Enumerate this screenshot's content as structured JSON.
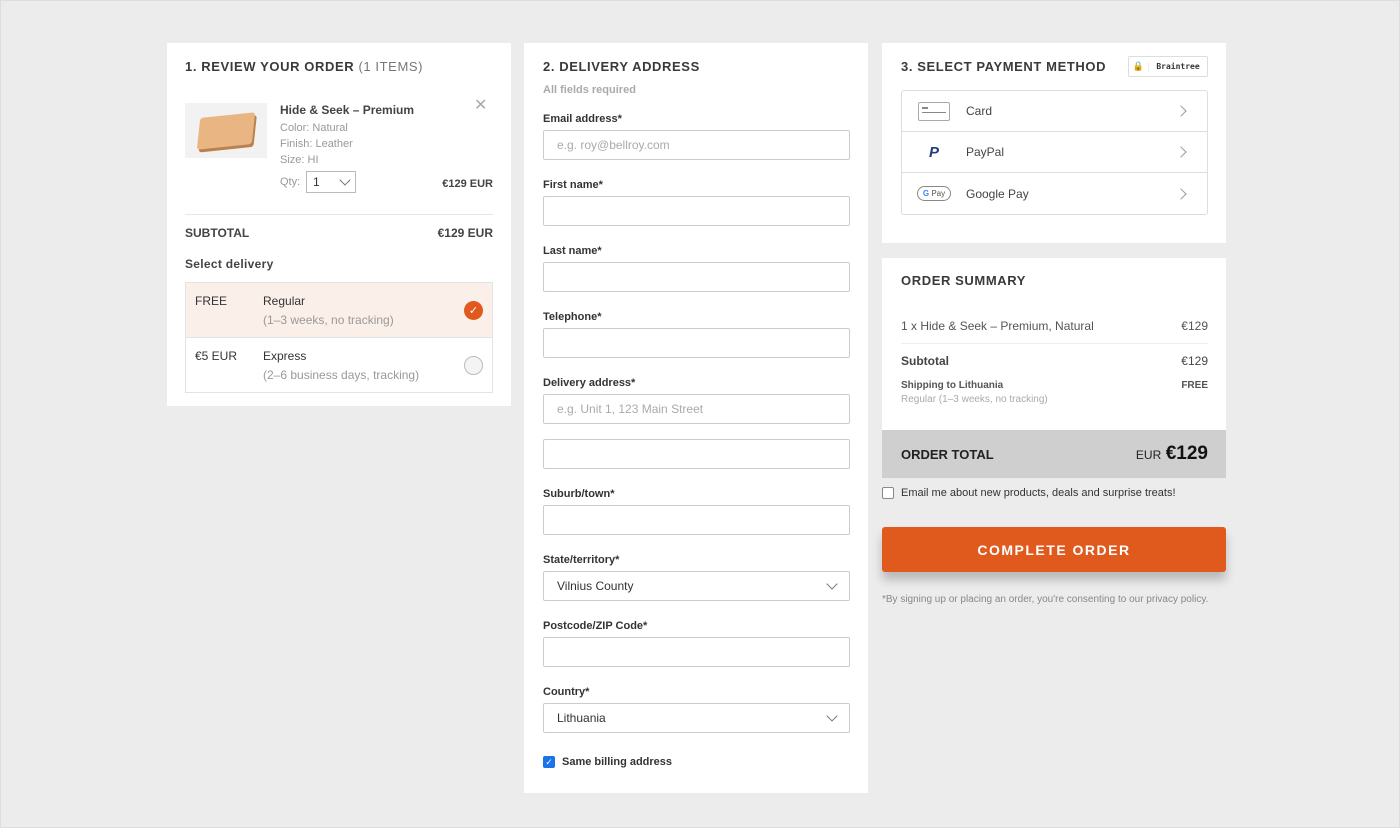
{
  "review": {
    "title": "1. REVIEW YOUR ORDER",
    "count": "(1 ITEMS)",
    "item": {
      "name": "Hide & Seek – Premium",
      "color": "Color: Natural",
      "finish": "Finish: Leather",
      "size": "Size: HI",
      "qty_label": "Qty:",
      "qty": "1",
      "price": "€129 EUR"
    },
    "subtotal_label": "SUBTOTAL",
    "subtotal": "€129 EUR",
    "delivery_label": "Select delivery",
    "delivery_options": [
      {
        "price": "FREE",
        "name": "Regular",
        "desc": "(1–3 weeks, no tracking)",
        "selected": true
      },
      {
        "price": "€5 EUR",
        "name": "Express",
        "desc": "(2–6 business days, tracking)",
        "selected": false
      }
    ]
  },
  "address": {
    "title": "2. DELIVERY ADDRESS",
    "note": "All fields required",
    "email_label": "Email address*",
    "email_placeholder": "e.g. roy@bellroy.com",
    "first_label": "First name*",
    "last_label": "Last name*",
    "phone_label": "Telephone*",
    "addr_label": "Delivery address*",
    "addr_placeholder": "e.g. Unit 1, 123 Main Street",
    "suburb_label": "Suburb/town*",
    "state_label": "State/territory*",
    "state": "Vilnius County",
    "postcode_label": "Postcode/ZIP Code*",
    "country_label": "Country*",
    "country": "Lithuania",
    "billing_label": "Same billing address",
    "billing_checked": true
  },
  "payment": {
    "title": "3. SELECT PAYMENT METHOD",
    "badge": "Braintree",
    "methods": [
      {
        "label": "Card",
        "icon": "credit-card-icon"
      },
      {
        "label": "PayPal",
        "icon": "paypal-icon"
      },
      {
        "label": "Google Pay",
        "icon": "google-pay-icon"
      }
    ]
  },
  "summary": {
    "title": "ORDER SUMMARY",
    "line": "1 x Hide & Seek – Premium, Natural",
    "line_price": "€129",
    "subtotal_label": "Subtotal",
    "subtotal": "€129",
    "shipping_label": "Shipping to Lithuania",
    "shipping_desc": "Regular (1–3 weeks, no tracking)",
    "shipping": "FREE",
    "total_label": "ORDER TOTAL",
    "total_currency": "EUR",
    "total": "€129"
  },
  "newsletter_label": "Email me about new products, deals and surprise treats!",
  "complete_button": "COMPLETE ORDER",
  "consent": "*By signing up or placing an order, you're consenting to our privacy policy.",
  "colors": {
    "accent": "#e05a1e",
    "selected_bg": "#fbefea",
    "total_bg": "#cfcfcf"
  }
}
